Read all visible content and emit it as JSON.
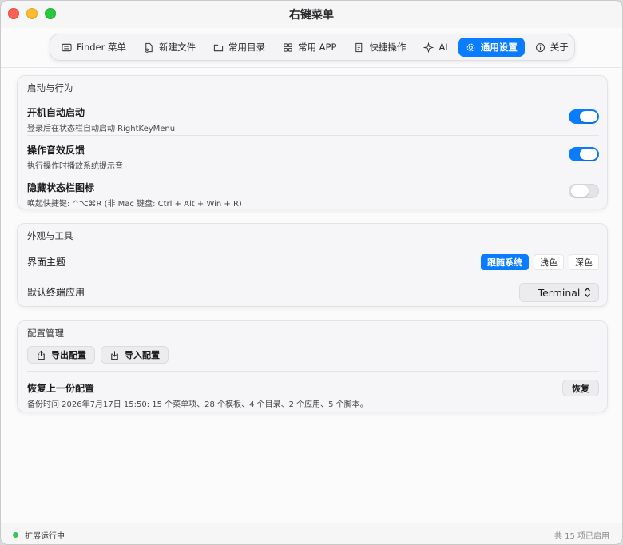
{
  "window": {
    "title": "右键菜单"
  },
  "tabs": [
    {
      "label": "Finder 菜单",
      "icon": "menu-list-icon"
    },
    {
      "label": "新建文件",
      "icon": "new-file-icon"
    },
    {
      "label": "常用目录",
      "icon": "folder-icon"
    },
    {
      "label": "常用 APP",
      "icon": "apps-grid-icon"
    },
    {
      "label": "快捷操作",
      "icon": "script-icon"
    },
    {
      "label": "AI",
      "icon": "sparkle-icon"
    },
    {
      "label": "通用设置",
      "icon": "gear-icon",
      "active": true
    },
    {
      "label": "关于",
      "icon": "info-icon"
    }
  ],
  "startup": {
    "title": "启动与行为",
    "launch_at_login": {
      "title": "开机自动启动",
      "desc": "登录后在状态栏自动启动 RightKeyMenu",
      "enabled": true
    },
    "sound_feedback": {
      "title": "操作音效反馈",
      "desc": "执行操作时播放系统提示音",
      "enabled": true
    },
    "hide_status_icon": {
      "title": "隐藏状态栏图标",
      "desc": "唤起快捷键: ^⌥⌘R (非 Mac 键盘: Ctrl + Alt + Win + R)",
      "enabled": false
    }
  },
  "appearance": {
    "title": "外观与工具",
    "theme_label": "界面主题",
    "theme_options": [
      "跟随系统",
      "浅色",
      "深色"
    ],
    "theme_selected": "跟随系统",
    "terminal_label": "默认终端应用",
    "terminal_value": "Terminal"
  },
  "config": {
    "title": "配置管理",
    "export_label": "导出配置",
    "import_label": "导入配置",
    "restore_title": "恢复上一份配置",
    "restore_desc": "备份时间 2026年7月17日 15:50: 15 个菜单项、28 个模板、4 个目录、2 个应用、5 个脚本。",
    "restore_button": "恢复"
  },
  "status": {
    "running": "扩展运行中",
    "enabled_count": "共 15 项已启用"
  },
  "colors": {
    "accent": "#0a7cff",
    "running": "#34c759"
  }
}
